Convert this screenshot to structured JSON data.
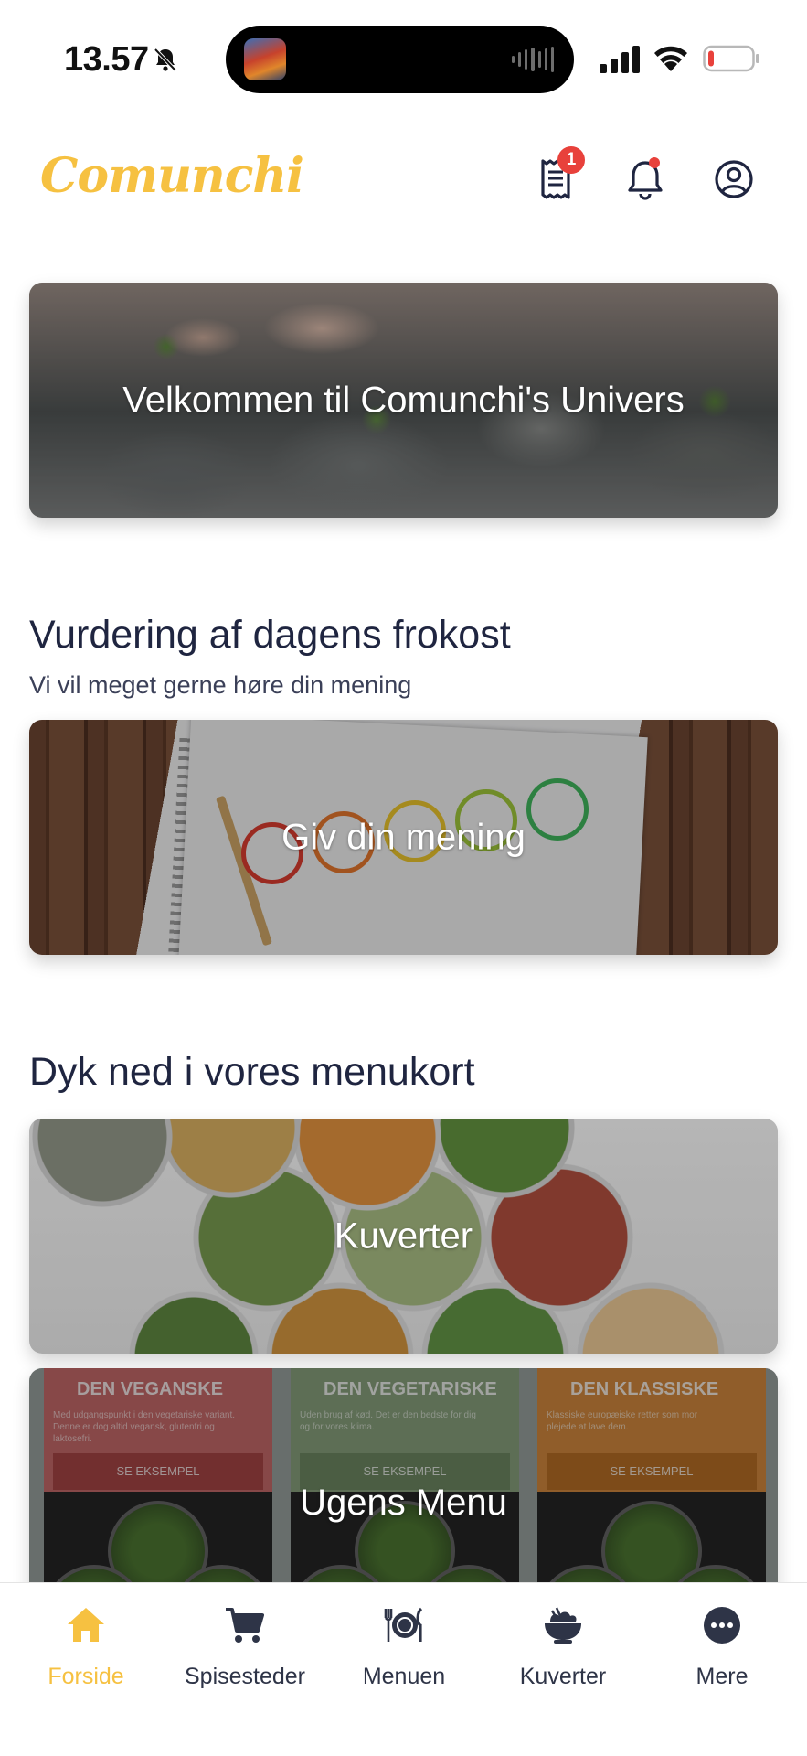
{
  "status_bar": {
    "time": "13.57",
    "icons": [
      "bell-slash-icon",
      "signal-icon",
      "wifi-icon",
      "battery-low-icon"
    ]
  },
  "header": {
    "logo": "Comunchi",
    "receipt_badge": "1",
    "icons": [
      "receipt-icon",
      "bell-icon",
      "account-icon"
    ]
  },
  "welcome_card": {
    "label": "Velkommen til Comunchi's Univers"
  },
  "rating_section": {
    "title": "Vurdering af dagens frokost",
    "subtitle": "Vi vil meget gerne høre din mening",
    "card_label": "Giv din mening"
  },
  "menu_section": {
    "title": "Dyk ned i vores menukort",
    "cards": [
      {
        "label": "Kuverter"
      },
      {
        "label": "Ugens Menu"
      }
    ],
    "weekly_columns": [
      {
        "title": "DEN VEGANSKE",
        "desc": "Med udgangspunkt i den vegetariske variant. Denne er dog altid vegansk, glutenfri og laktosefri.",
        "button": "SE EKSEMPEL",
        "color": "#c86a6a"
      },
      {
        "title": "DEN VEGETARISKE",
        "desc": "Uden brug af kød. Det er den bedste for dig og for vores klima.",
        "button": "SE EKSEMPEL",
        "color": "#8aa37e"
      },
      {
        "title": "DEN KLASSISKE",
        "desc": "Klassiske europæiske retter som mor plejede at lave dem.",
        "button": "SE EKSEMPEL",
        "color": "#d48a3e"
      }
    ]
  },
  "bottom_nav": {
    "active_color": "#f6c141",
    "items": [
      {
        "label": "Forside",
        "icon": "home-icon",
        "active": true
      },
      {
        "label": "Spisesteder",
        "icon": "cart-icon",
        "active": false
      },
      {
        "label": "Menuen",
        "icon": "plate-cutlery-icon",
        "active": false
      },
      {
        "label": "Kuverter",
        "icon": "bowl-icon",
        "active": false
      },
      {
        "label": "Mere",
        "icon": "more-icon",
        "active": false
      }
    ]
  }
}
